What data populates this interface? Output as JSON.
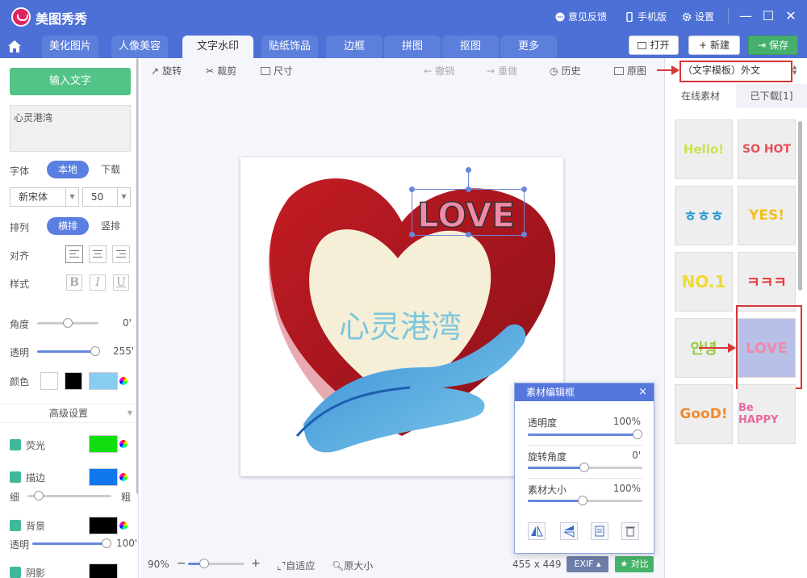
{
  "app": {
    "title": "美图秀秀"
  },
  "titlebar": {
    "feedback": "意见反馈",
    "mobile": "手机版",
    "settings": "设置"
  },
  "tabs": [
    "美化图片",
    "人像美容",
    "文字水印",
    "贴纸饰品",
    "边框",
    "拼图",
    "抠图",
    "更多"
  ],
  "active_tab": "文字水印",
  "actions": {
    "open": "打开",
    "new": "新建",
    "save": "保存"
  },
  "toolbar": {
    "rotate": "旋转",
    "crop": "裁剪",
    "size": "尺寸",
    "undo": "撤销",
    "redo": "重做",
    "history": "历史",
    "original": "原图"
  },
  "left": {
    "input_text_button": "输入文字",
    "text_content": "心灵港湾",
    "font_label": "字体",
    "font_local": "本地",
    "font_download": "下载",
    "font_family": "新宋体",
    "font_size": "50",
    "layout_label": "排列",
    "layout_horizontal": "横排",
    "layout_vertical": "竖排",
    "align_label": "对齐",
    "style_label": "样式",
    "style_bold": "B",
    "style_italic": "I",
    "style_underline": "U",
    "angle_label": "角度",
    "angle_value": "0'",
    "opacity_label": "透明",
    "opacity_value": "255'",
    "color_label": "颜色",
    "advanced": "高级设置",
    "glow_label": "荧光",
    "stroke_label": "描边",
    "thin_label": "细",
    "thick_label": "粗",
    "bg_label": "背景",
    "bg_opacity_label": "透明",
    "bg_opacity_value": "100'",
    "shadow_label": "阴影"
  },
  "canvas": {
    "watermark_text": "心灵港湾",
    "sticker_text": "LOVE"
  },
  "status": {
    "zoom": "90%",
    "fit": "自适应",
    "original_size": "原大小",
    "dimensions": "455 x 449",
    "exif": "EXIF",
    "compare": "对比"
  },
  "popup": {
    "title": "素材编辑框",
    "close": "×",
    "opacity_label": "透明度",
    "opacity_value": "100%",
    "rotation_label": "旋转角度",
    "rotation_value": "0'",
    "size_label": "素材大小",
    "size_value": "100%"
  },
  "right": {
    "category": "（文字模板）外文",
    "tab_online": "在线素材",
    "tab_downloaded": "已下载[1]",
    "thumbs": [
      "Hello!",
      "SO HOT",
      "ㅎㅎㅎ",
      "YES!",
      "NO.1",
      "ㅋㅋㅋ",
      "안녕",
      "LOVE",
      "GooD!",
      "Be HAPPY"
    ]
  },
  "colors": {
    "accent": "#4c70d6",
    "green": "#52c487",
    "highlight": "#d93636",
    "glow": "#11dd11",
    "stroke": "#1177ee",
    "text_color": "#88ccf0"
  }
}
